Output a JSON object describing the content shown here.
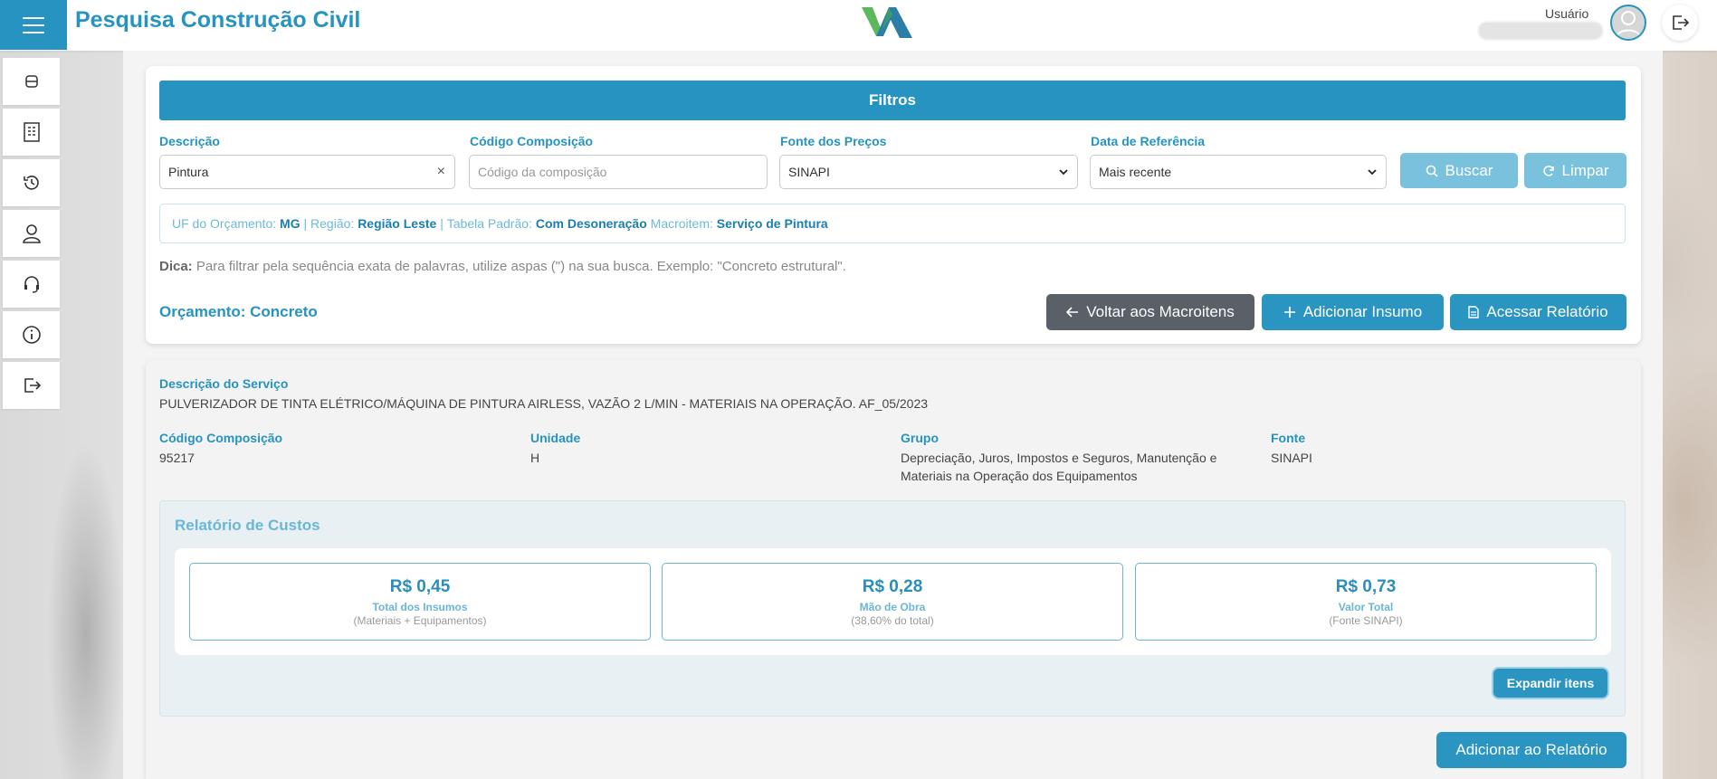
{
  "header": {
    "title": "Pesquisa Construção Civil",
    "user_label": "Usuário"
  },
  "sidebar": {
    "items": [
      {
        "icon": "database-icon"
      },
      {
        "icon": "building-icon"
      },
      {
        "icon": "history-icon"
      },
      {
        "icon": "user-icon"
      },
      {
        "icon": "headset-icon"
      },
      {
        "icon": "info-icon"
      },
      {
        "icon": "logout-icon"
      }
    ]
  },
  "filters": {
    "title": "Filtros",
    "descricao": {
      "label": "Descrição",
      "value": "Pintura"
    },
    "codigo": {
      "label": "Código Composição",
      "placeholder": "Código da composição"
    },
    "fonte": {
      "label": "Fonte dos Preços",
      "value": "SINAPI"
    },
    "data_ref": {
      "label": "Data de Referência",
      "value": "Mais recente"
    },
    "buscar_label": "Buscar",
    "limpar_label": "Limpar"
  },
  "context": {
    "uf_label": "UF do Orçamento: ",
    "uf_value": "MG",
    "sep1": " | ",
    "regiao_label": "Região: ",
    "regiao_value": "Região Leste",
    "sep2": " | ",
    "tabela_label": "Tabela Padrão: ",
    "tabela_value": "Com Desoneração",
    "macro_label": " Macroitem: ",
    "macro_value": "Serviço de Pintura"
  },
  "tip": {
    "label": "Dica:",
    "text": " Para filtrar pela sequência exata de palavras, utilize aspas (\") na sua busca. Exemplo: \"Concreto estrutural\"."
  },
  "budget": {
    "title": "Orçamento: Concreto",
    "back_label": "Voltar aos Macroitens",
    "add_label": "Adicionar Insumo",
    "report_label": "Acessar Relatório"
  },
  "service": {
    "desc_label": "Descrição do Serviço",
    "desc_value": "PULVERIZADOR DE TINTA ELÉTRICO/MÁQUINA DE PINTURA AIRLESS, VAZÃO 2 L/MIN - MATERIAIS NA OPERAÇÃO. AF_05/2023",
    "codigo_label": "Código Composição",
    "codigo_value": "95217",
    "unidade_label": "Unidade",
    "unidade_value": "H",
    "grupo_label": "Grupo",
    "grupo_value_1": "Depreciação, Juros, Impostos e Seguros, Manutenção e",
    "grupo_value_2": "Materiais na Operação dos Equipamentos",
    "fonte_label": "Fonte",
    "fonte_value": "SINAPI"
  },
  "costs": {
    "title": "Relatório de Custos",
    "boxes": [
      {
        "amount": "R$ 0,45",
        "caption": "Total dos Insumos",
        "sub": "(Materiais + Equipamentos)"
      },
      {
        "amount": "R$ 0,28",
        "caption": "Mão de Obra",
        "sub": "(38,60% do total)"
      },
      {
        "amount": "R$ 0,73",
        "caption": "Valor Total",
        "sub": "(Fonte SINAPI)"
      }
    ],
    "expand_label": "Expandir itens",
    "add_report_label": "Adicionar ao Relatório"
  },
  "colors": {
    "primary": "#2693c0",
    "light_button": "#79c1dd",
    "dark_button": "#5a6068"
  }
}
